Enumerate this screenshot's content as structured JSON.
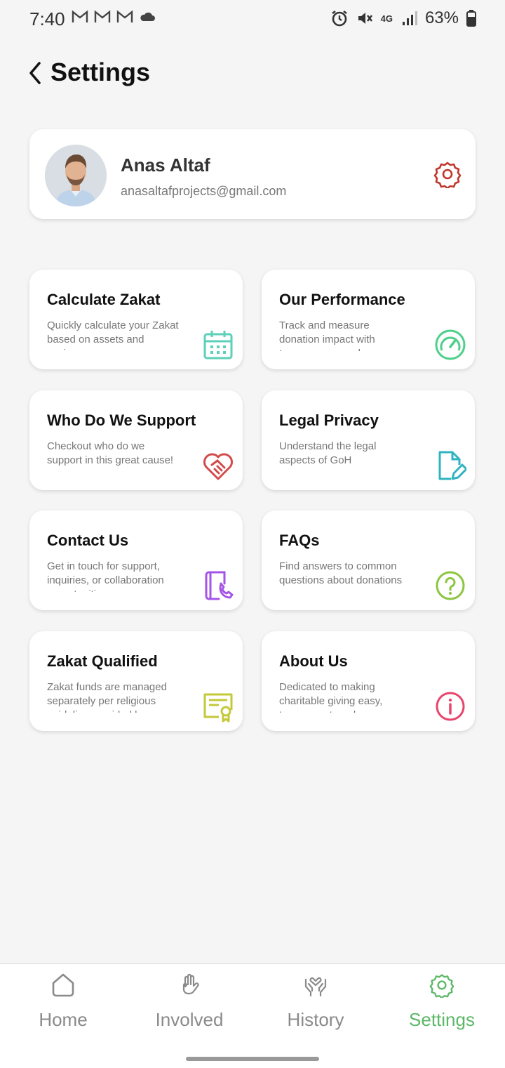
{
  "status": {
    "time": "7:40",
    "network": "4G",
    "battery": "63%"
  },
  "header": {
    "title": "Settings"
  },
  "profile": {
    "name": "Anas Altaf",
    "email": "anasaltafprojects@gmail.com"
  },
  "cards": [
    {
      "title": "Calculate Zakat",
      "desc": "Quickly calculate your Zakat based on assets and savings",
      "icon": "calendar-icon",
      "color": "#5ecfb8"
    },
    {
      "title": "Our Performance",
      "desc": "Track and measure donation impact with transparency and",
      "icon": "gauge-icon",
      "color": "#4fcf8a"
    },
    {
      "title": "Who Do We Support",
      "desc": "Checkout who do we support in this great cause!",
      "icon": "handshake-heart-icon",
      "color": "#d34a4a"
    },
    {
      "title": "Legal Privacy",
      "desc": "Understand the legal aspects of GoH",
      "icon": "document-edit-icon",
      "color": "#2fb3c0"
    },
    {
      "title": "Contact Us",
      "desc": "Get in touch for support, inquiries, or collaboration opportunities",
      "icon": "contact-book-icon",
      "color": "#a455e8"
    },
    {
      "title": "FAQs",
      "desc": "Find answers to common questions about donations",
      "icon": "question-circle-icon",
      "color": "#8cc640"
    },
    {
      "title": "Zakat Qualified",
      "desc": "Zakat funds are managed separately per religious guidelines, guided by",
      "icon": "certificate-icon",
      "color": "#c4c93a"
    },
    {
      "title": "About Us",
      "desc": "Dedicated to making charitable giving easy, transparent, and",
      "icon": "info-circle-icon",
      "color": "#e8456a"
    }
  ],
  "nav": {
    "items": [
      {
        "label": "Home",
        "icon": "home-icon"
      },
      {
        "label": "Involved",
        "icon": "raised-hand-icon"
      },
      {
        "label": "History",
        "icon": "heart-hands-icon"
      },
      {
        "label": "Settings",
        "icon": "gear-icon"
      }
    ],
    "active_color": "#5cb868",
    "inactive_color": "#8a8a8a"
  }
}
